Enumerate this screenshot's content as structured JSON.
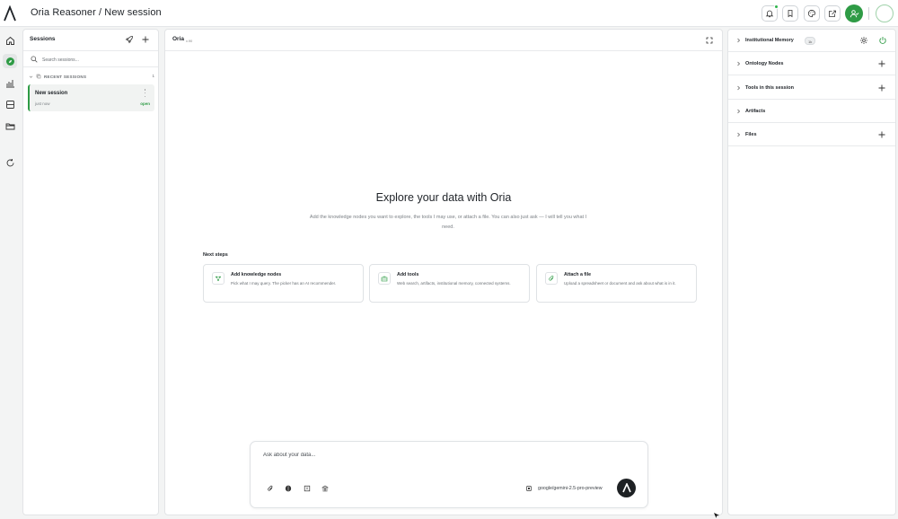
{
  "header": {
    "title": "Oria Reasoner / New session"
  },
  "sidebar_rail": {
    "items": [
      "home",
      "explore",
      "analytics",
      "storage",
      "folders",
      "refresh"
    ],
    "active": "explore"
  },
  "sessions": {
    "title": "Sessions",
    "search_placeholder": "Search sessions...",
    "section_label": "RECENT SESSIONS",
    "section_count": "1",
    "items": [
      {
        "name": "New session",
        "time": "just now",
        "status": "open"
      }
    ]
  },
  "main": {
    "title": "Oria",
    "version": "v.90",
    "hero_title": "Explore your data with Oria",
    "hero_subtitle": "Add the knowledge nodes you want to explore, the tools I may use, or attach a file. You can also just ask — I will tell you what I need.",
    "next_steps_label": "Next steps",
    "steps": [
      {
        "title": "Add knowledge nodes",
        "desc": "Pick what I may query. The picker has an AI recommender."
      },
      {
        "title": "Add tools",
        "desc": "Web search, artifacts, institutional memory, connected systems."
      },
      {
        "title": "Attach a file",
        "desc": "Upload a spreadsheet or document and ask about what is in it."
      }
    ],
    "composer": {
      "placeholder": "Ask about your data...",
      "model": "google/gemini-2.5-pro-preview"
    }
  },
  "right_panel": {
    "sections": [
      {
        "label": "Institutional Memory",
        "badge": "1k"
      },
      {
        "label": "Ontology Nodes"
      },
      {
        "label": "Tools in this session"
      },
      {
        "label": "Artifacts"
      },
      {
        "label": "Files"
      }
    ]
  },
  "colors": {
    "accent": "#2e9b45",
    "send": "#1e2124"
  }
}
